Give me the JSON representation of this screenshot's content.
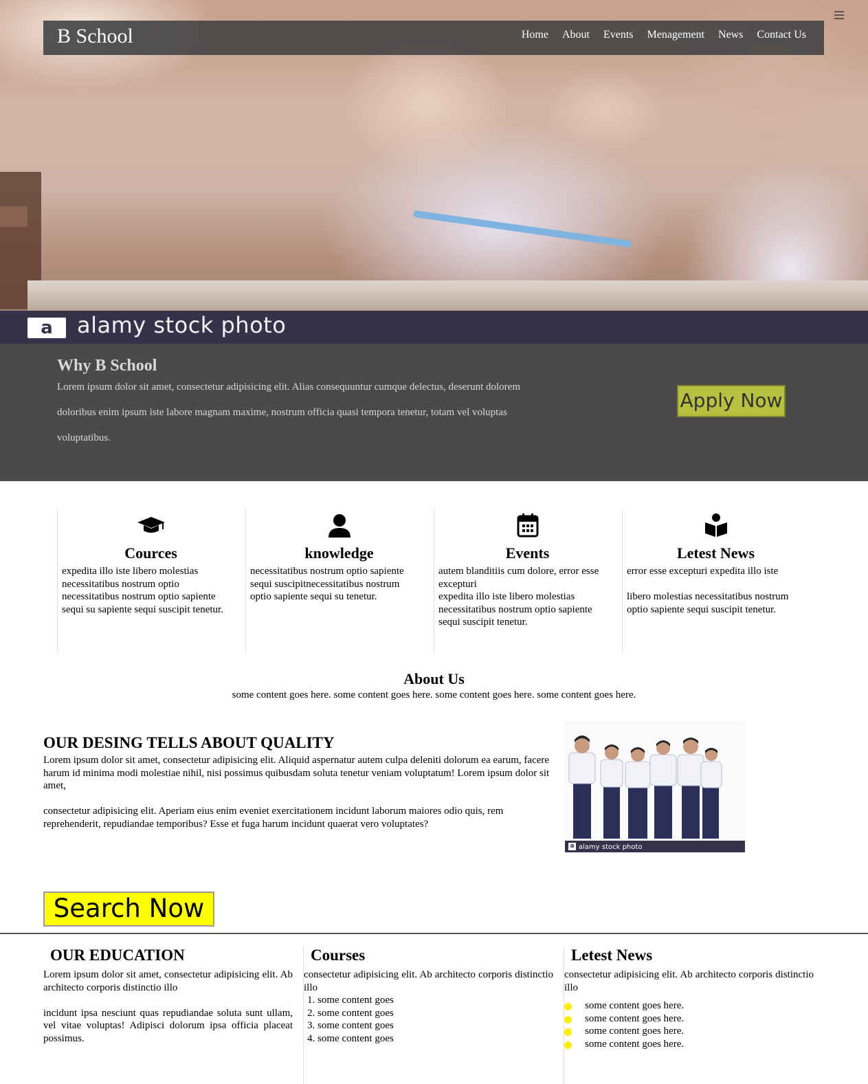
{
  "brand": "B School",
  "nav": [
    "Home",
    "About",
    "Events",
    "Menagement",
    "News",
    "Contact Us"
  ],
  "hero": {
    "watermark_logo": "a",
    "watermark_text": "alamy stock photo"
  },
  "why": {
    "title": "Why B School",
    "text": "Lorem ipsum dolor sit amet, consectetur adipisicing elit. Alias consequuntur cumque delectus, deserunt dolorem doloribus enim ipsum iste labore magnam maxime, nostrum officia quasi tempora tenetur, totam vel voluptas voluptatibus.",
    "apply_label": "Apply Now"
  },
  "features": [
    {
      "icon": "graduation-cap-icon",
      "title": "Cources",
      "lines": [
        "expedita illo iste libero molestias necessitatibus nostrum optio necessitatibus nostrum optio sapiente sequi su sapiente sequi suscipit tenetur."
      ]
    },
    {
      "icon": "user-icon",
      "title": "knowledge",
      "lines": [
        "necessitatibus nostrum optio sapiente sequi suscipitnecessitatibus nostrum optio sapiente sequi su tenetur."
      ]
    },
    {
      "icon": "calendar-icon",
      "title": "Events",
      "lines": [
        "autem blanditiis cum dolore, error esse excepturi",
        "expedita illo iste libero molestias necessitatibus nostrum optio sapiente sequi suscipit tenetur."
      ]
    },
    {
      "icon": "reader-icon",
      "title": "Letest News",
      "lines": [
        "error esse excepturi expedita illo iste",
        "",
        "libero molestias necessitatibus nostrum optio sapiente sequi suscipit tenetur."
      ]
    }
  ],
  "about": {
    "title": "About Us",
    "text": "some content goes here. some content goes here. some content goes here. some content goes here."
  },
  "quality": {
    "title": "OUR DESING TELLS ABOUT QUALITY",
    "para1": "Lorem ipsum dolor sit amet, consectetur adipisicing elit. Aliquid aspernatur autem culpa deleniti dolorum ea earum, facere harum id minima modi molestiae nihil, nisi possimus quibusdam soluta tenetur veniam voluptatum! Lorem ipsum dolor sit amet,",
    "para2": "consectetur adipisicing elit. Aperiam eius enim eveniet exercitationem incidunt laborum maiores odio quis, rem reprehenderit, repudiandae temporibus? Esse et fuga harum incidunt quaerat vero voluptates?",
    "image_logo": "a",
    "image_caption": "alamy stock photo"
  },
  "search_label": "Search Now",
  "footer": {
    "education": {
      "title": "OUR EDUCATION",
      "para1": "Lorem ipsum dolor sit amet, consectetur adipisicing elit. Ab architecto corporis distinctio illo",
      "para2": "incidunt ipsa nesciunt quas repudiandae soluta sunt ullam, vel vitae voluptas! Adipisci dolorum ipsa officia placeat possimus."
    },
    "courses": {
      "title": "Courses",
      "text": "consectetur adipisicing elit. Ab architecto corporis distinctio illo",
      "items": [
        "some content goes",
        "some content goes",
        "some content goes",
        "some content goes"
      ]
    },
    "news": {
      "title": "Letest News",
      "text": "consectetur adipisicing elit. Ab architecto corporis distinctio illo",
      "items": [
        "some content goes here.",
        "some content goes here.",
        "some content goes here.",
        "some content goes here."
      ]
    }
  },
  "colors": {
    "navbar": "#464646",
    "why_bg": "#4a4a4a",
    "apply_btn": "#b8c040",
    "search_btn": "#ffff00",
    "bullet": "#ffee00"
  }
}
